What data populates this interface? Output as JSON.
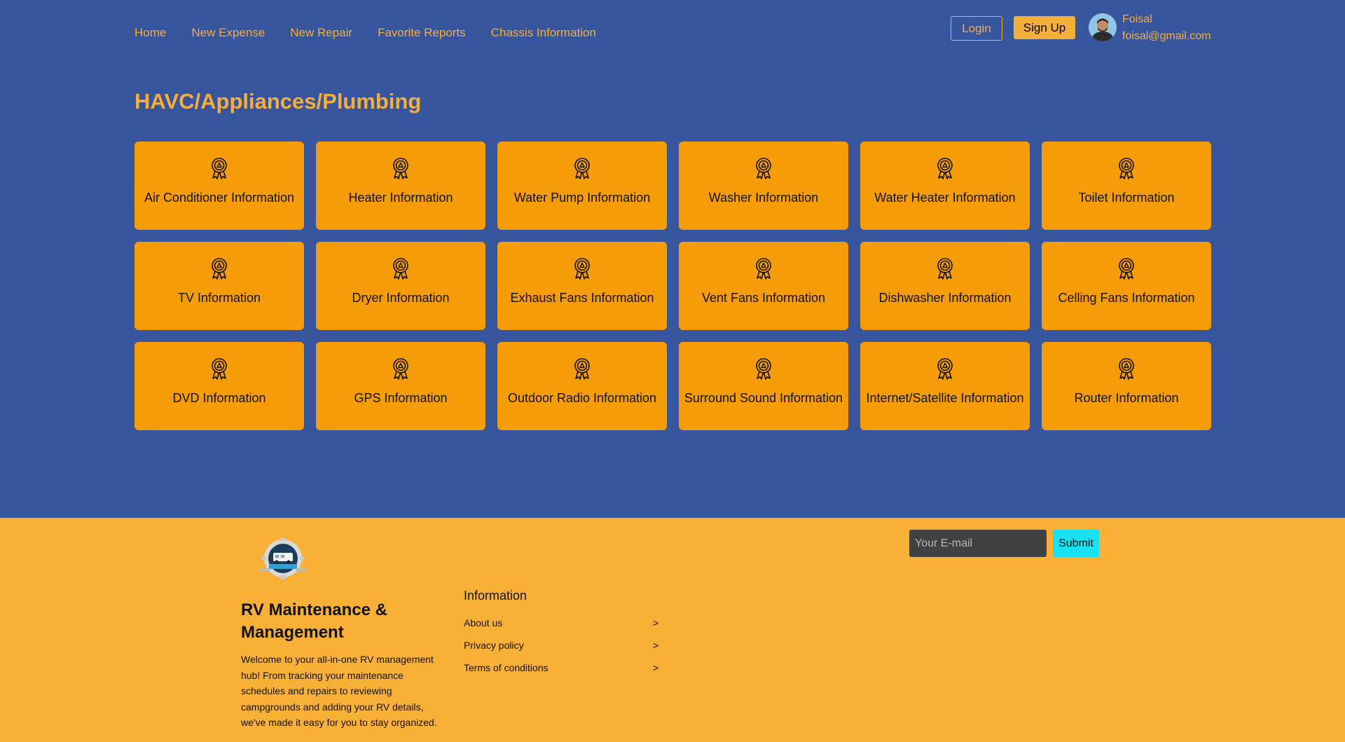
{
  "nav": {
    "items": [
      "Home",
      "New Expense",
      "New Repair",
      "Favorite Reports",
      "Chassis Information"
    ]
  },
  "auth": {
    "login_label": "Login",
    "signup_label": "Sign Up"
  },
  "user": {
    "name": "Foisal",
    "email": "foisal@gmail.com"
  },
  "page": {
    "title": "HAVC/Appliances/Plumbing"
  },
  "cards": [
    {
      "label": "Air Conditioner Information",
      "icon": "award-ribbon-icon"
    },
    {
      "label": "Heater Information",
      "icon": "award-ribbon-icon"
    },
    {
      "label": "Water Pump Information",
      "icon": "award-ribbon-icon"
    },
    {
      "label": "Washer Information",
      "icon": "award-ribbon-icon"
    },
    {
      "label": "Water Heater Information",
      "icon": "award-ribbon-icon"
    },
    {
      "label": "Toilet Information",
      "icon": "award-ribbon-icon"
    },
    {
      "label": "TV Information",
      "icon": "award-ribbon-icon"
    },
    {
      "label": "Dryer Information",
      "icon": "award-ribbon-icon"
    },
    {
      "label": "Exhaust Fans Information",
      "icon": "award-ribbon-icon"
    },
    {
      "label": "Vent Fans Information",
      "icon": "award-ribbon-icon"
    },
    {
      "label": "Dishwasher Information",
      "icon": "award-ribbon-icon"
    },
    {
      "label": "Celling Fans Information",
      "icon": "award-ribbon-icon"
    },
    {
      "label": "DVD Information",
      "icon": "award-ribbon-icon"
    },
    {
      "label": "GPS Information",
      "icon": "award-ribbon-icon"
    },
    {
      "label": "Outdoor Radio Information",
      "icon": "award-ribbon-icon"
    },
    {
      "label": "Surround Sound Information",
      "icon": "award-ribbon-icon"
    },
    {
      "label": "Internet/Satellite Information",
      "icon": "award-ribbon-icon"
    },
    {
      "label": "Router Information",
      "icon": "award-ribbon-icon"
    }
  ],
  "footer": {
    "brand_title": "RV Maintenance & Management",
    "brand_description": "Welcome to your all-in-one RV management hub! From tracking your maintenance schedules and repairs to reviewing campgrounds and adding your RV details, we've made it easy for you to stay organized.",
    "info_title": "Information",
    "info_links": [
      {
        "label": "About us",
        "arrow": ">"
      },
      {
        "label": "Privacy policy",
        "arrow": ">"
      },
      {
        "label": "Terms of conditions",
        "arrow": ">"
      }
    ],
    "email_placeholder": "Your E-mail",
    "submit_label": "Submit"
  },
  "colors": {
    "background": "#37559c",
    "accent": "#f6ae3b",
    "card": "#f59c07",
    "footer": "#f8b036",
    "submit": "#17e2f2"
  }
}
